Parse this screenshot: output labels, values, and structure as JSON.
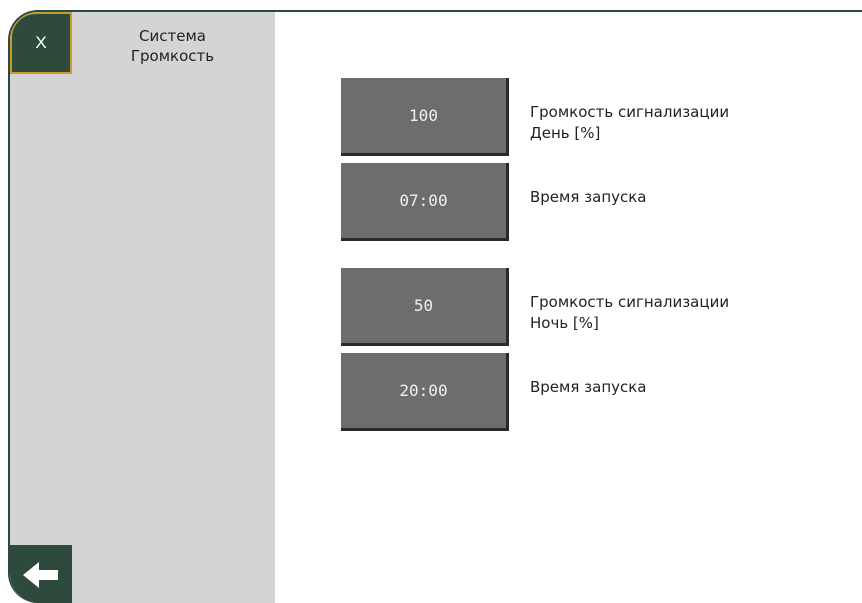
{
  "header": {
    "close_label": "X",
    "title_line1": "Система",
    "title_line2": "Громкость"
  },
  "day": {
    "volume_value": "100",
    "volume_label_line1": "Громкость сигнализации",
    "volume_label_line2": "День [%]",
    "time_value": "07:00",
    "time_label": "Время запуска"
  },
  "night": {
    "volume_value": "50",
    "volume_label_line1": "Громкость сигнализации",
    "volume_label_line2": "Ночь [%]",
    "time_value": "20:00",
    "time_label": "Время запуска"
  },
  "icons": {
    "close": "close-icon",
    "back": "back-arrow-icon"
  },
  "colors": {
    "accent": "#2e4a3c",
    "highlight": "#c99a2e",
    "button": "#6d6d6d",
    "sidebar": "#d4d4d4"
  }
}
